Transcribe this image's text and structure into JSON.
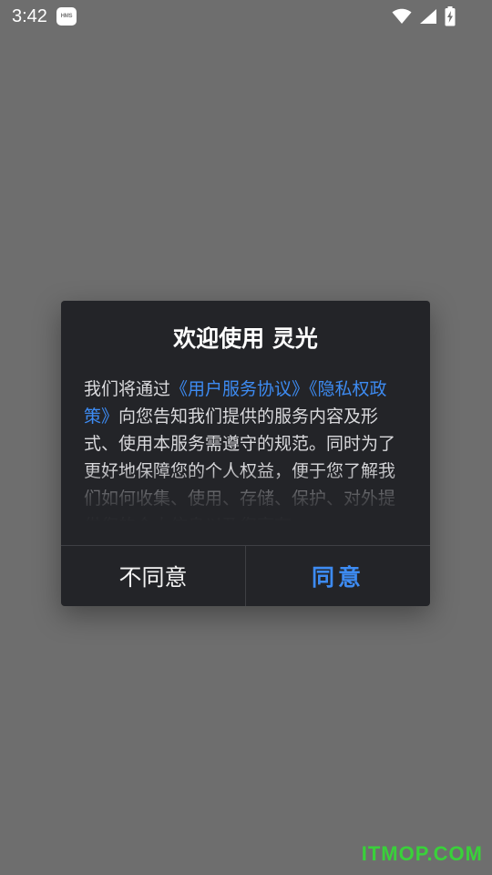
{
  "status_bar": {
    "time": "3:42",
    "badge": "HMS",
    "icons": [
      "wifi-icon",
      "cellular-signal-icon",
      "battery-charging-icon"
    ]
  },
  "dialog": {
    "title": "欢迎使用 灵光",
    "body": {
      "before": "我们将通过",
      "link_user_agreement": "《用户服务协议》",
      "link_privacy_policy": "《隐私权政策》",
      "after": "向您告知我们提供的服务内容及形式、使用本服务需遵守的规范。同时为了更好地保障您的个人权益，便于您了解我们如何收集、使用、存储、保护、对外提供您的个人信息以及您享有"
    },
    "disagree_label": "不同意",
    "agree_label": "同意"
  },
  "watermark": "ITMOP.COM",
  "colors": {
    "backdrop": "#6e6e6e",
    "dialog_bg": "#232428",
    "link": "#3d8bf2",
    "watermark": "#39d13a"
  }
}
